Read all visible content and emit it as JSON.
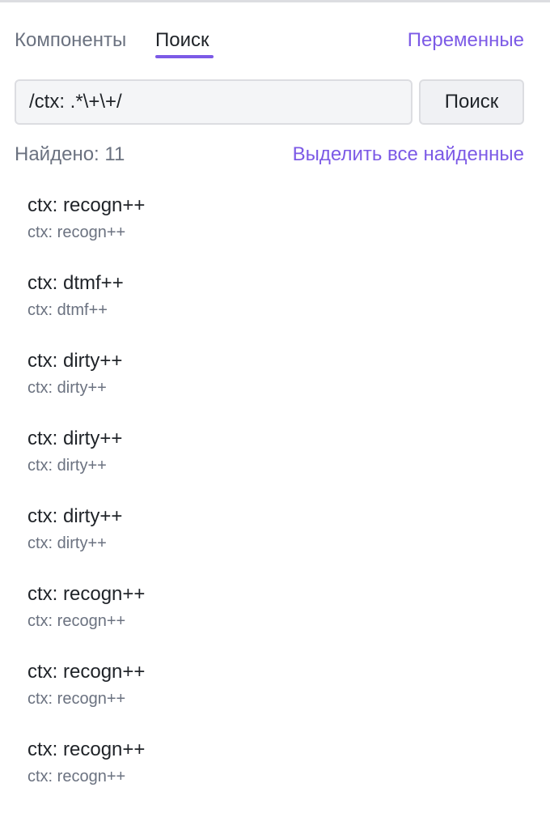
{
  "tabs": {
    "components": "Компоненты",
    "search": "Поиск",
    "variables": "Переменные",
    "active": "search"
  },
  "search": {
    "value": "/ctx: .*\\+\\+/",
    "button_label": "Поиск"
  },
  "summary": {
    "found_text": "Найдено: 11",
    "select_all_label": "Выделить все найденные"
  },
  "results": [
    {
      "title": "ctx: recogn++",
      "subtitle": "ctx: recogn++"
    },
    {
      "title": "ctx: dtmf++",
      "subtitle": "ctx: dtmf++"
    },
    {
      "title": "ctx: dirty++",
      "subtitle": "ctx: dirty++"
    },
    {
      "title": "ctx: dirty++",
      "subtitle": "ctx: dirty++"
    },
    {
      "title": "ctx: dirty++",
      "subtitle": "ctx: dirty++"
    },
    {
      "title": "ctx: recogn++",
      "subtitle": "ctx: recogn++"
    },
    {
      "title": "ctx: recogn++",
      "subtitle": "ctx: recogn++"
    },
    {
      "title": "ctx: recogn++",
      "subtitle": "ctx: recogn++"
    }
  ],
  "colors": {
    "accent": "#7c5ae6",
    "text": "#1f2328",
    "muted": "#6b7280",
    "border": "#dcdde1",
    "input_bg": "#f4f5f7"
  }
}
